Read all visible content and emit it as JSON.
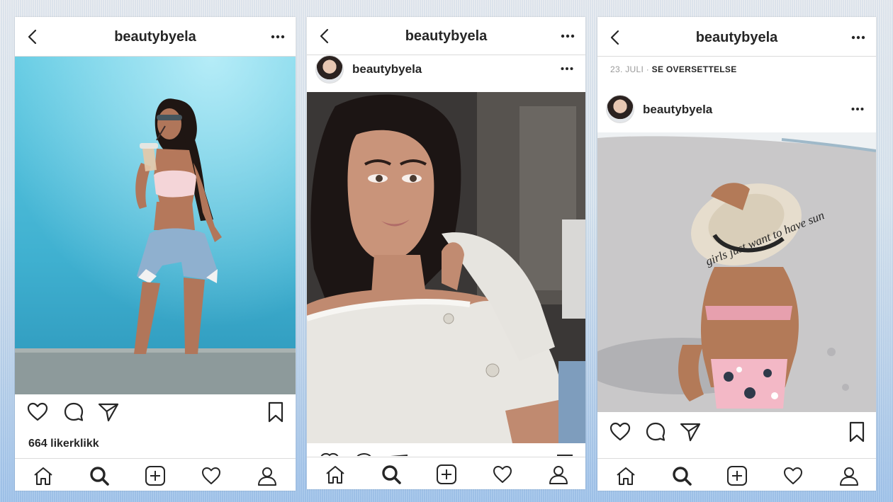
{
  "colors": {
    "text": "#262626",
    "muted": "#999999",
    "divider": "#dbdbdb",
    "background": "#ffffff"
  },
  "icons": {
    "back": "back-chevron-icon",
    "more": "more-dots-icon",
    "like": "heart-outline-icon",
    "comment": "comment-bubble-icon",
    "share": "paper-plane-icon",
    "save": "bookmark-outline-icon",
    "home": "home-icon",
    "search": "search-icon",
    "add": "add-post-icon",
    "activity": "heart-icon",
    "profile": "profile-icon"
  },
  "screens": [
    {
      "header_title": "beautybyela",
      "likes": "664 likerklikk",
      "photo_description": "Woman in pink crop top and denim shorts drinking iced coffee against a turquoise wall"
    },
    {
      "header_title": "beautybyela",
      "post_username": "beautybyela",
      "photo_description": "Selfie of woman in white off-shoulder ribbed knit top"
    },
    {
      "header_title": "beautybyela",
      "date": "23. JULI",
      "separator": "·",
      "translate_label": "SE OVERSETTELSE",
      "post_username": "beautybyela",
      "photo_description": "Woman sitting on sand wearing a straw hat reading 'girls just want to have sun'",
      "hat_text": "girls just want to have sun"
    }
  ]
}
